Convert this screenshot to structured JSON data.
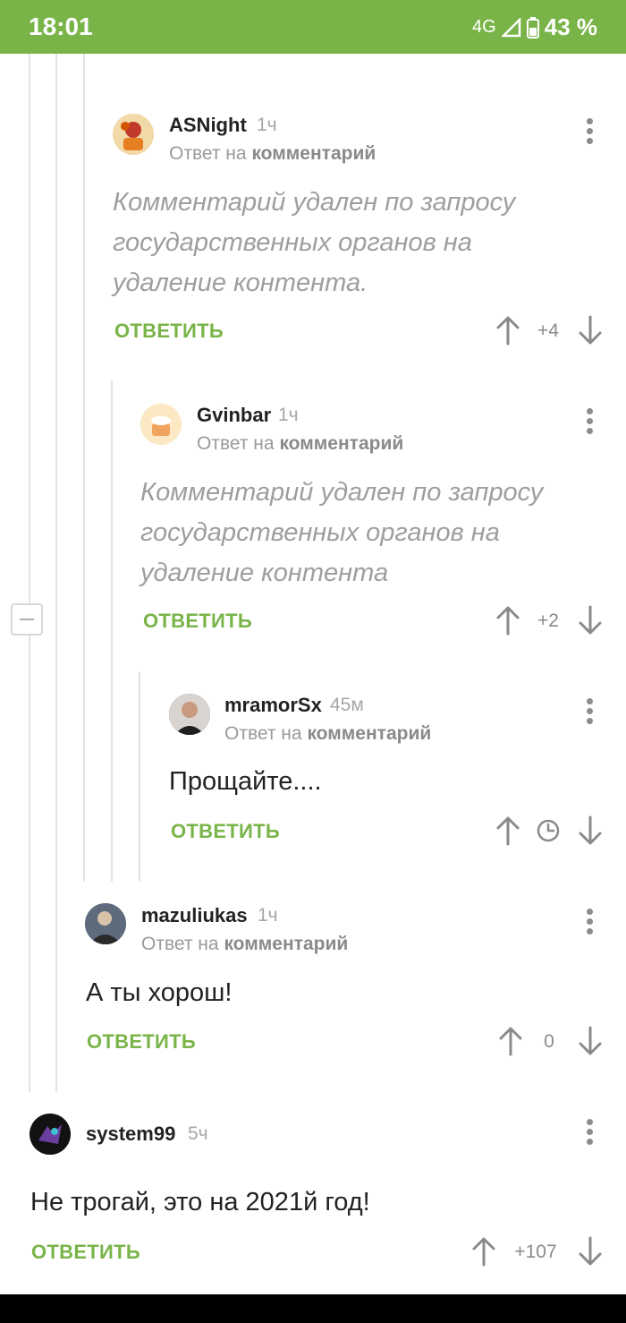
{
  "status_bar": {
    "time": "18:01",
    "network": "4G",
    "battery": "43 %"
  },
  "reply_label": "ОТВЕТИТЬ",
  "reply_to_prefix": "Ответ на",
  "reply_to_link": "комментарий",
  "comments": [
    {
      "username": "ASNight",
      "time": "1ч",
      "text": "Комментарий удален по запросу государственных органов на удаление контента.",
      "rating": "+4"
    },
    {
      "username": "Gvinbar",
      "time": "1ч",
      "text": "Комментарий удален по запросу государственных органов на удаление контента",
      "rating": "+2"
    },
    {
      "username": "mramorSx",
      "time": "45м",
      "text": "Прощайте....",
      "rating": ""
    },
    {
      "username": "mazuliukas",
      "time": "1ч",
      "text": "А ты хорош!",
      "rating": "0"
    },
    {
      "username": "system99",
      "time": "5ч",
      "text": "Не трогай, это на 2021й год!",
      "rating": "+107"
    }
  ],
  "colors": {
    "accent": "#79b448",
    "deleted_text": "#9e9e9e"
  }
}
